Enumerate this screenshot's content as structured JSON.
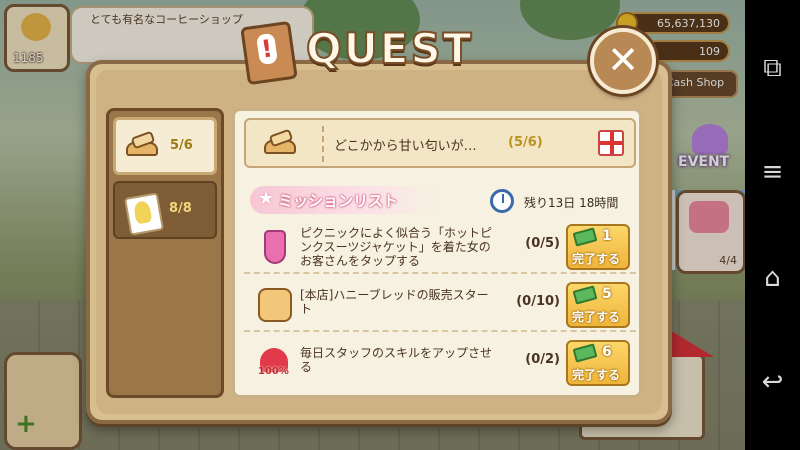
{
  "hud": {
    "level": "1185",
    "speech": "とても有名なコーヒーショップ",
    "coins": "65,637,130",
    "gems": "109",
    "cash_shop": "Cash Shop"
  },
  "side": {
    "event": "EVENT",
    "cake_count": "4/4"
  },
  "dialog": {
    "title": "QUEST",
    "tabs": [
      {
        "progress": "5/6"
      },
      {
        "progress": "8/8"
      }
    ],
    "quest": {
      "text": "どこかから甘い匂いが…",
      "progress": "(5/6)"
    },
    "mission_list_title": "ミッションリスト",
    "time_left": "残り13日 18時間",
    "missions": [
      {
        "text": "ピクニックによく似合う「ホットピンクスーツジャケット」を着た女のお客さんをタップする",
        "progress": "(0/5)",
        "reward": "1",
        "button": "完了する"
      },
      {
        "text": "[本店]ハニーブレッドの販売スタート",
        "progress": "(0/10)",
        "reward": "5",
        "button": "完了する"
      },
      {
        "text": "毎日スタッフのスキルをアップさせる",
        "progress": "(0/2)",
        "reward": "6",
        "button": "完了する",
        "badge": "100%"
      }
    ]
  }
}
